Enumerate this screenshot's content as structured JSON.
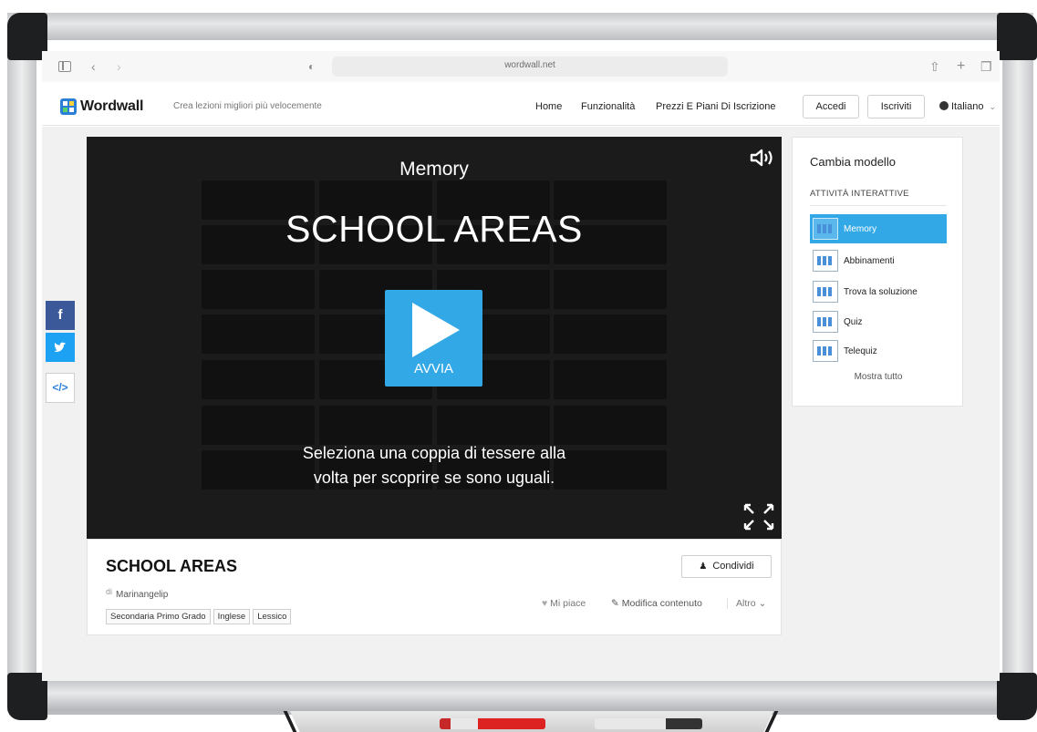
{
  "browser": {
    "url": "wordwall.net"
  },
  "header": {
    "logo_text": "Wordwall",
    "tagline": "Crea lezioni migliori più velocemente",
    "nav": [
      "Home",
      "Funzionalità",
      "Prezzi E Piani Di Iscrizione"
    ],
    "login_label": "Accedi",
    "signup_label": "Iscriviti",
    "language": "Italiano"
  },
  "game": {
    "type": "Memory",
    "title": "SCHOOL AREAS",
    "play_label": "AVVIA",
    "instructions_line1": "Seleziona una coppia di tessere alla",
    "instructions_line2": "volta per scoprire se sono uguali."
  },
  "info": {
    "title": "SCHOOL AREAS",
    "by_prefix": "di",
    "author": "Marinangelip",
    "tags": [
      "Secondaria Primo Grado",
      "Inglese",
      "Lessico"
    ],
    "share_label": "Condividi",
    "like_label": "Mi piace",
    "edit_label": "Modifica contenuto",
    "more_label": "Altro"
  },
  "panel": {
    "title": "Cambia modello",
    "subtitle": "ATTIVITÀ INTERATTIVE",
    "templates": [
      "Memory",
      "Abbinamenti",
      "Trova la soluzione",
      "Quiz",
      "Telequiz"
    ],
    "active_template": "Memory",
    "show_all": "Mostra tutto"
  },
  "social": {
    "facebook_glyph": "f",
    "embed_glyph": "</>"
  },
  "colors": {
    "accent": "#33a8e6",
    "facebook": "#3b5998",
    "twitter": "#1da1f2",
    "game_bg": "#1b1b1b"
  }
}
